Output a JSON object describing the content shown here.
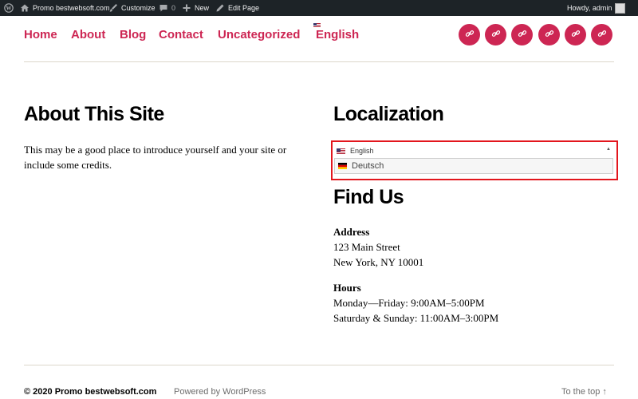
{
  "admin_bar": {
    "site_name": "Promo bestwebsoft.com",
    "customize": "Customize",
    "comments_count": "0",
    "new": "New",
    "edit_page": "Edit Page",
    "greeting": "Howdy, admin"
  },
  "nav": {
    "items": [
      "Home",
      "About",
      "Blog",
      "Contact",
      "Uncategorized",
      "English"
    ]
  },
  "social": {
    "icons": [
      "link-icon",
      "link-icon",
      "link-icon",
      "link-icon",
      "link-icon",
      "link-icon"
    ]
  },
  "about": {
    "title": "About This Site",
    "text": "This may be a good place to introduce yourself and your site or include some credits."
  },
  "localization": {
    "title": "Localization",
    "selected": "English",
    "option": "Deutsch"
  },
  "find_us": {
    "title": "Find Us",
    "address_label": "Address",
    "address_line1": "123 Main Street",
    "address_line2": "New York, NY 10001",
    "hours_label": "Hours",
    "hours_line1": "Monday—Friday: 9:00AM–5:00PM",
    "hours_line2": "Saturday & Sunday: 11:00AM–3:00PM"
  },
  "footer": {
    "copyright": "© 2020 Promo bestwebsoft.com",
    "powered": "Powered by WordPress",
    "to_top": "To the top ↑"
  },
  "colors": {
    "accent": "#cd2653",
    "admin_bar": "#1d2327",
    "highlight_border": "#e3161d"
  }
}
